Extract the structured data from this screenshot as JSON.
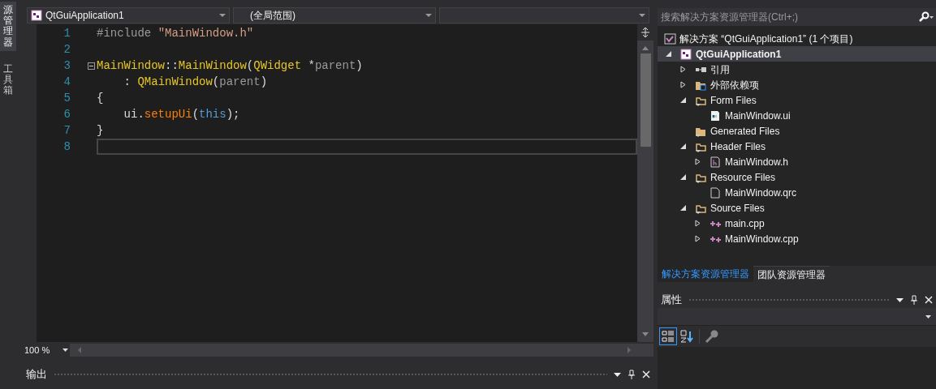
{
  "side_tabs": [
    {
      "label": "源管理器",
      "selected": true
    },
    {
      "label": "工具箱",
      "selected": false
    }
  ],
  "editor": {
    "nav": {
      "project": "QtGuiApplication1",
      "scope": "(全局范围)"
    },
    "lines": [
      {
        "number": "1",
        "fold": false,
        "tokens": [
          {
            "text": "#include ",
            "kind": "preproc"
          },
          {
            "text": "\"MainWindow.h\"",
            "kind": "string"
          }
        ]
      },
      {
        "number": "2",
        "fold": false
      },
      {
        "number": "3",
        "fold": true,
        "tokens": [
          {
            "text": "MainWindow",
            "kind": "type"
          },
          {
            "text": "::",
            "kind": "plain"
          },
          {
            "text": "MainWindow",
            "kind": "type"
          },
          {
            "text": "(",
            "kind": "plain"
          },
          {
            "text": "QWidget",
            "kind": "type"
          },
          {
            "text": " *",
            "kind": "plain"
          },
          {
            "text": "parent",
            "kind": "param"
          },
          {
            "text": ")",
            "kind": "plain"
          }
        ]
      },
      {
        "number": "4",
        "fold": false,
        "tokens": [
          {
            "text": "    : ",
            "kind": "plain"
          },
          {
            "text": "QMainWindow",
            "kind": "type"
          },
          {
            "text": "(",
            "kind": "plain"
          },
          {
            "text": "parent",
            "kind": "param"
          },
          {
            "text": ")",
            "kind": "plain"
          }
        ]
      },
      {
        "number": "5",
        "fold": false,
        "tokens": [
          {
            "text": "{",
            "kind": "plain"
          }
        ]
      },
      {
        "number": "6",
        "fold": false,
        "tokens": [
          {
            "text": "    ui.",
            "kind": "plain"
          },
          {
            "text": "setupUi",
            "kind": "func"
          },
          {
            "text": "(",
            "kind": "plain"
          },
          {
            "text": "this",
            "kind": "keyword"
          },
          {
            "text": ");",
            "kind": "plain"
          }
        ]
      },
      {
        "number": "7",
        "fold": false,
        "tokens": [
          {
            "text": "}",
            "kind": "plain"
          }
        ]
      },
      {
        "number": "8",
        "fold": false,
        "current": true
      }
    ],
    "zoom": "100 %"
  },
  "output": {
    "title": "输出"
  },
  "solution_explorer": {
    "search": {
      "placeholder": "搜索解决方案资源管理器(Ctrl+;)"
    },
    "solution": "解决方案 “QtGuiApplication1” (1 个项目)",
    "tree": [
      {
        "label": "QtGuiApplication1",
        "kind": "project",
        "expanded": true,
        "selected": true,
        "children": [
          {
            "label": "引用",
            "kind": "references",
            "expanded": false,
            "selected": false
          },
          {
            "label": "外部依赖项",
            "kind": "external",
            "expanded": false,
            "selected": false
          },
          {
            "label": "Form Files",
            "kind": "filter",
            "expanded": true,
            "selected": false,
            "children": [
              {
                "label": "MainWindow.ui",
                "kind": "ui",
                "selected": false
              }
            ]
          },
          {
            "label": "Generated Files",
            "kind": "folder",
            "selected": false
          },
          {
            "label": "Header Files",
            "kind": "filter",
            "expanded": true,
            "selected": false,
            "children": [
              {
                "label": "MainWindow.h",
                "kind": "header",
                "expanded": false,
                "selected": false
              }
            ]
          },
          {
            "label": "Resource Files",
            "kind": "filter",
            "expanded": true,
            "selected": false,
            "children": [
              {
                "label": "MainWindow.qrc",
                "kind": "file",
                "selected": false
              }
            ]
          },
          {
            "label": "Source Files",
            "kind": "filter",
            "expanded": true,
            "selected": false,
            "children": [
              {
                "label": "main.cpp",
                "kind": "cpp",
                "expanded": false,
                "selected": false
              },
              {
                "label": "MainWindow.cpp",
                "kind": "cpp",
                "expanded": false,
                "selected": false
              }
            ]
          }
        ]
      }
    ],
    "tabs": [
      {
        "label": "解决方案资源管理器",
        "selected": true
      },
      {
        "label": "团队资源管理器",
        "selected": false
      }
    ]
  },
  "properties": {
    "title": "属性"
  }
}
